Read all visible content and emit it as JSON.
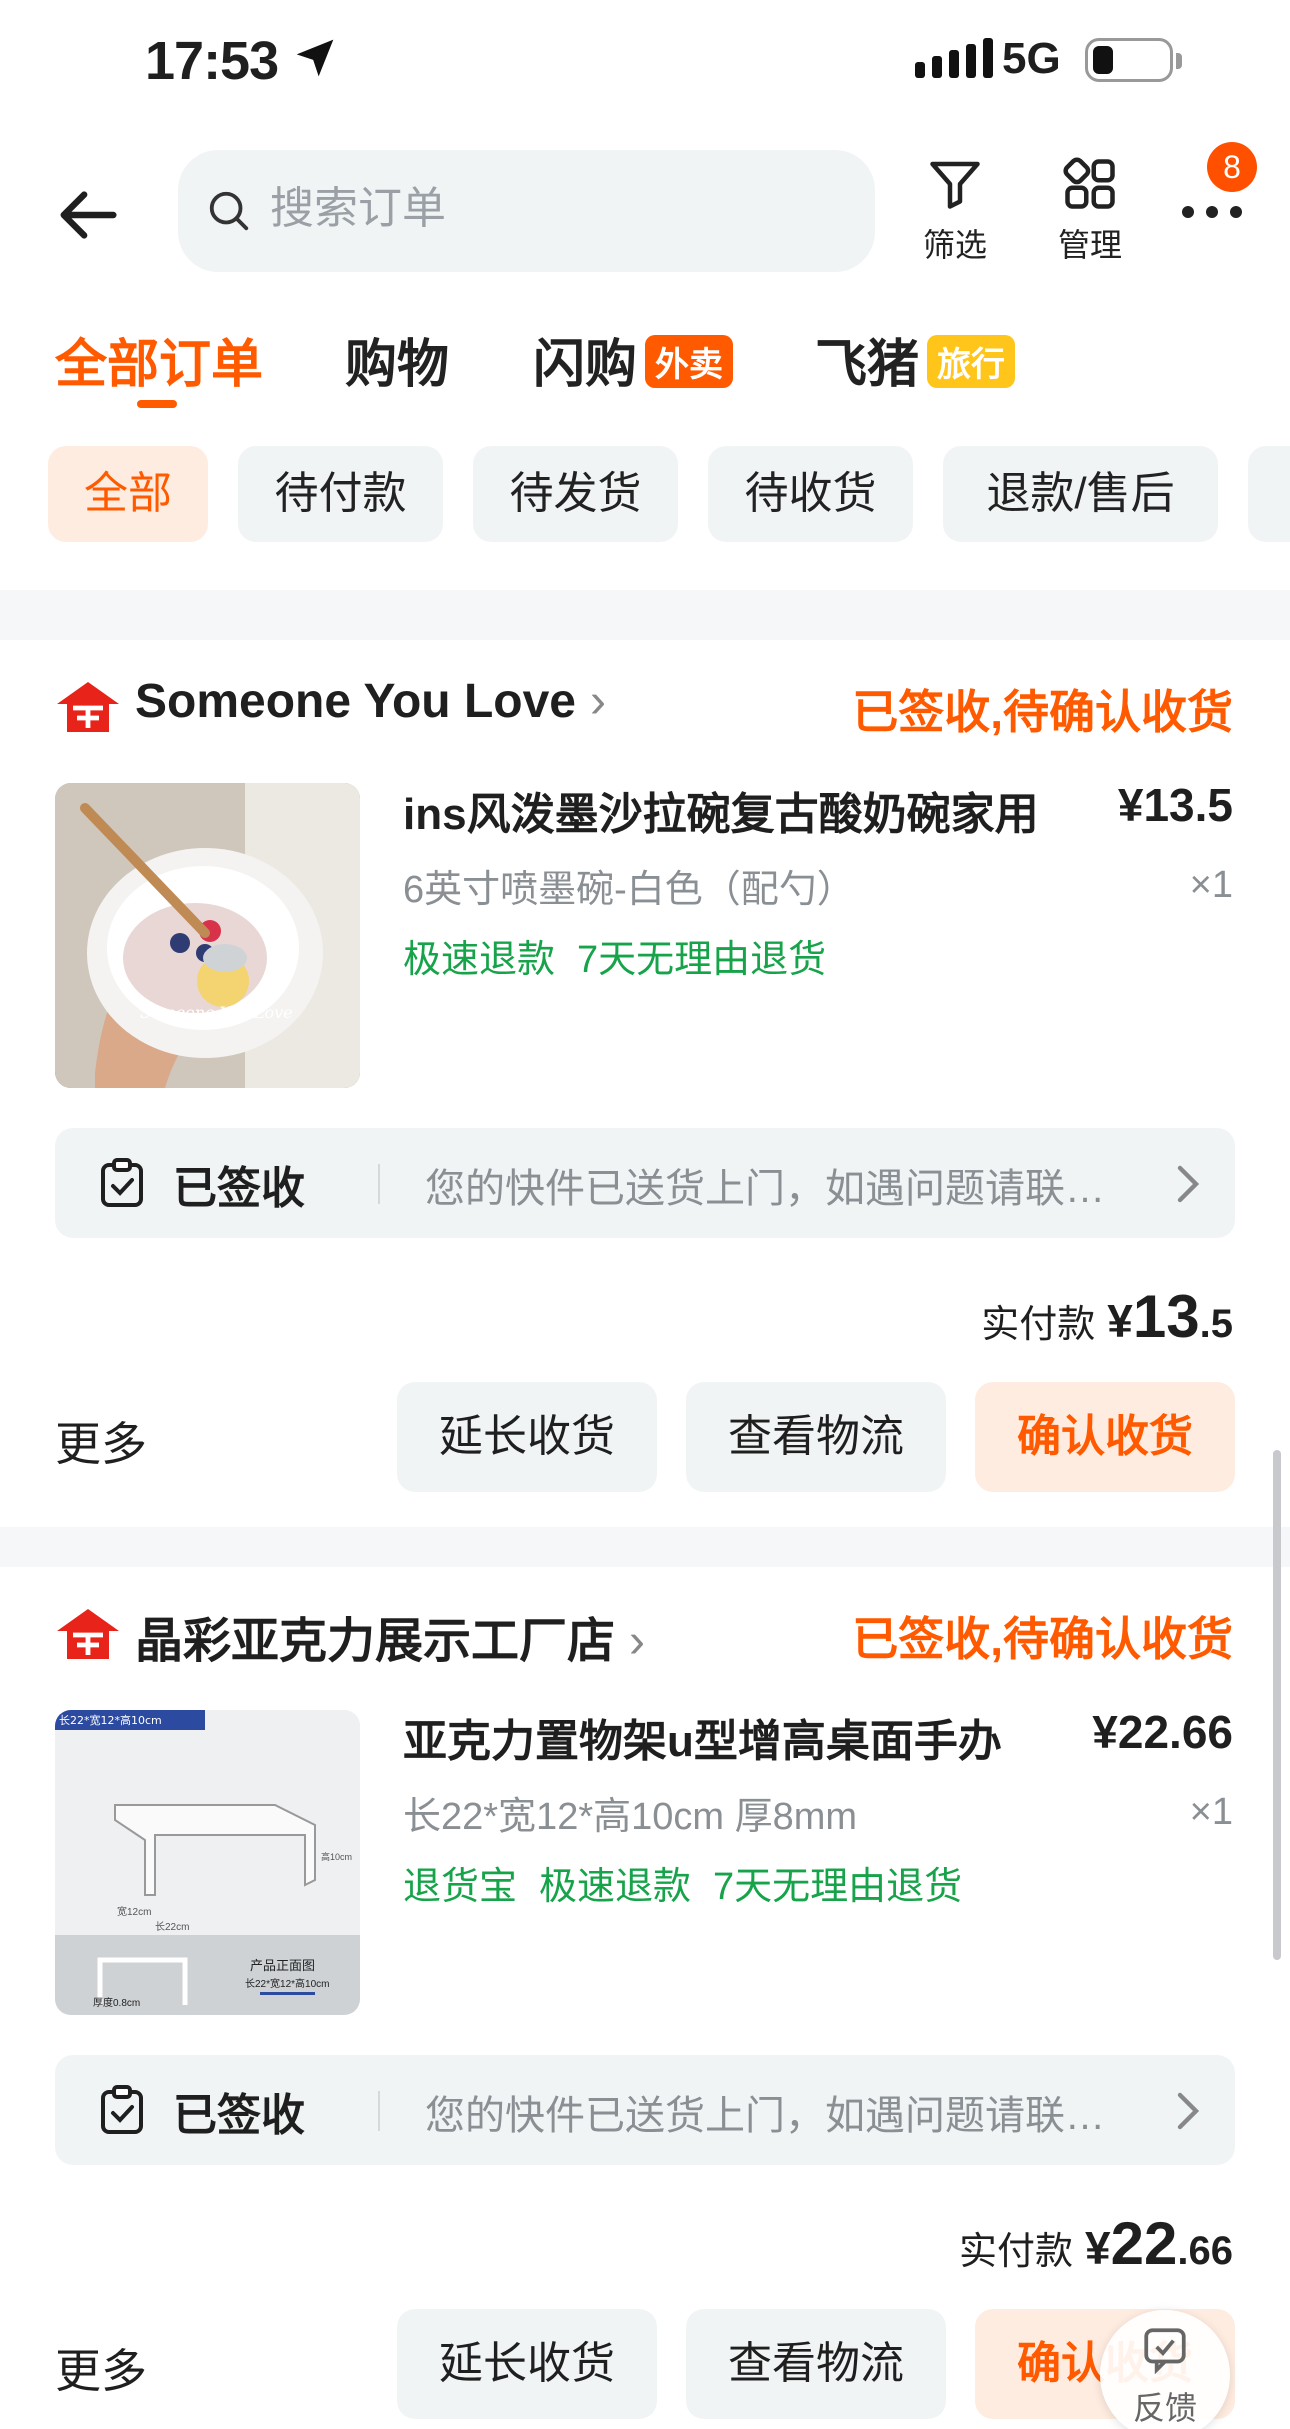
{
  "status_bar": {
    "time": "17:53",
    "network": "5G"
  },
  "header": {
    "search_placeholder": "搜索订单",
    "filter_label": "筛选",
    "manage_label": "管理",
    "message_badge": "8"
  },
  "tabs": [
    {
      "label": "全部订单",
      "tag": ""
    },
    {
      "label": "购物",
      "tag": ""
    },
    {
      "label": "闪购",
      "tag": "外卖"
    },
    {
      "label": "飞猪",
      "tag": "旅行"
    }
  ],
  "chips": [
    "全部",
    "待付款",
    "待发货",
    "待收货",
    "退款/售后"
  ],
  "orders": [
    {
      "shop": "Someone You Love",
      "status": "已签收,待确认收货",
      "title": "ins风泼墨沙拉碗复古酸奶碗家用",
      "price": "¥13.5",
      "spec": "6英寸喷墨碗-白色（配勺）",
      "qty": "×1",
      "tags": [
        "极速退款",
        "7天无理由退货"
      ],
      "thumb_text": "Someone You Love",
      "logistics_status": "已签收",
      "logistics_msg": "您的快件已送货上门，如遇问题请联…",
      "paid_label": "实付款",
      "paid_currency": "¥",
      "paid_int": "13",
      "paid_dec": ".5",
      "more": "更多",
      "buttons": [
        "延长收货",
        "查看物流",
        "确认收货"
      ]
    },
    {
      "shop": "晶彩亚克力展示工厂店",
      "status": "已签收,待确认收货",
      "title": "亚克力置物架u型增高桌面手办",
      "price": "¥22.66",
      "spec": "长22*宽12*高10cm 厚8mm",
      "qty": "×1",
      "tags": [
        "退货宝",
        "极速退款",
        "7天无理由退货"
      ],
      "thumb_dim": "长22*宽12*高10cm",
      "thumb_front": "产品正面图",
      "thumb_front_dim": "长22*宽12*高10cm",
      "thumb_thick": "厚度0.8cm",
      "thumb_len": "长22cm",
      "thumb_wid": "宽12cm",
      "thumb_hei": "高10cm",
      "logistics_status": "已签收",
      "logistics_msg": "您的快件已送货上门，如遇问题请联…",
      "paid_label": "实付款",
      "paid_currency": "¥",
      "paid_int": "22",
      "paid_dec": ".66",
      "more": "更多",
      "buttons": [
        "延长收货",
        "查看物流",
        "确认收货"
      ]
    }
  ],
  "feedback_label": "反馈",
  "colors": {
    "accent": "#ff5a00",
    "green": "#17a34a",
    "gray_text": "#8a8f94",
    "takeout_tag": "#ff5a00",
    "travel_tag": "#ffc51a"
  },
  "icons": [
    "location-arrow-icon",
    "back-arrow-icon",
    "search-icon",
    "filter-icon",
    "grid-icon",
    "more-dots-icon",
    "shop-icon",
    "clipboard-check-icon",
    "chevron-right-icon",
    "feedback-icon"
  ]
}
